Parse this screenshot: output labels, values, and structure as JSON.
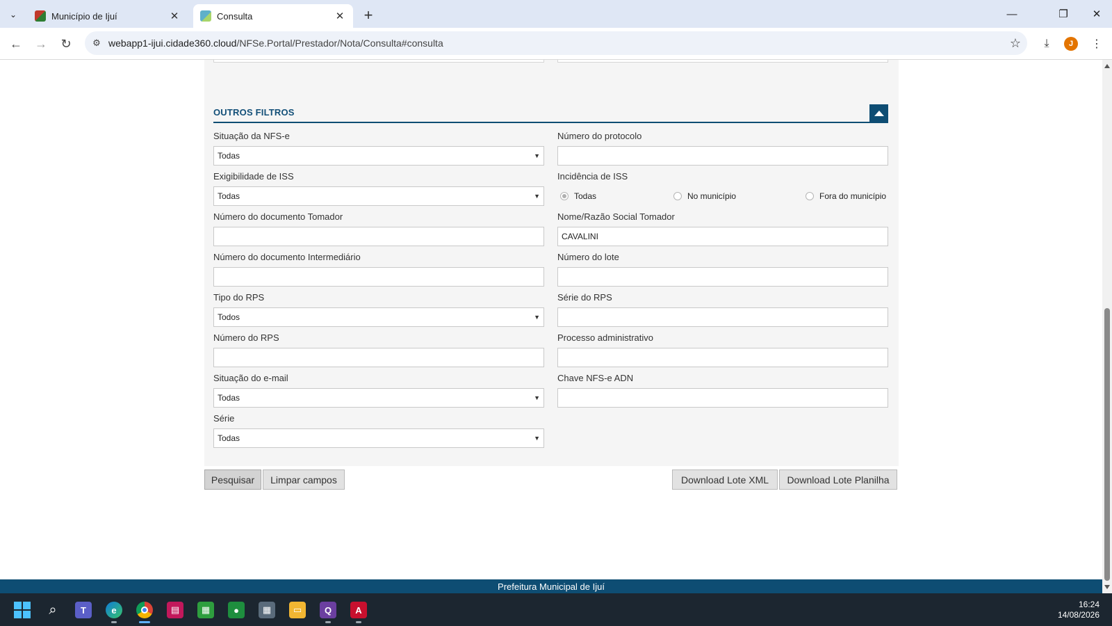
{
  "browser": {
    "tabs": [
      {
        "label": "Município de Ijuí",
        "active": false
      },
      {
        "label": "Consulta",
        "active": true
      }
    ],
    "url_host": "webapp1-ijui.cidade360.cloud",
    "url_path": "/NFSe.Portal/Prestador/Nota/Consulta#consulta",
    "profile_initial": "J"
  },
  "section": {
    "title": "OUTROS FILTROS"
  },
  "fields": {
    "situacao_nfse": {
      "label": "Situação da NFS-e",
      "value": "Todas"
    },
    "numero_protocolo": {
      "label": "Número do protocolo",
      "value": ""
    },
    "exigibilidade_iss": {
      "label": "Exigibilidade de ISS",
      "value": "Todas"
    },
    "incidencia_iss": {
      "label": "Incidência de ISS",
      "options": [
        "Todas",
        "No município",
        "Fora do município"
      ],
      "selected": "Todas"
    },
    "doc_tomador": {
      "label": "Número do documento Tomador",
      "value": ""
    },
    "nome_tomador": {
      "label": "Nome/Razão Social Tomador",
      "value": "CAVALINI"
    },
    "doc_intermediario": {
      "label": "Número do documento Intermediário",
      "value": ""
    },
    "numero_lote": {
      "label": "Número do lote",
      "value": ""
    },
    "tipo_rps": {
      "label": "Tipo do RPS",
      "value": "Todos"
    },
    "serie_rps": {
      "label": "Série do RPS",
      "value": ""
    },
    "numero_rps": {
      "label": "Número do RPS",
      "value": ""
    },
    "processo_adm": {
      "label": "Processo administrativo",
      "value": ""
    },
    "situacao_email": {
      "label": "Situação do e-mail",
      "value": "Todas"
    },
    "chave_nfse_adn": {
      "label": "Chave NFS-e ADN",
      "value": ""
    },
    "serie": {
      "label": "Série",
      "value": "Todas"
    }
  },
  "buttons": {
    "pesquisar": "Pesquisar",
    "limpar": "Limpar campos",
    "download_xml": "Download Lote XML",
    "download_planilha": "Download Lote Planilha"
  },
  "footer": {
    "text": "Prefeitura Municipal de Ijuí"
  },
  "taskbar": {
    "time": "16:24",
    "date": "14/08/2026"
  },
  "colors": {
    "brand": "#0e4d73",
    "heading": "#124f78"
  }
}
